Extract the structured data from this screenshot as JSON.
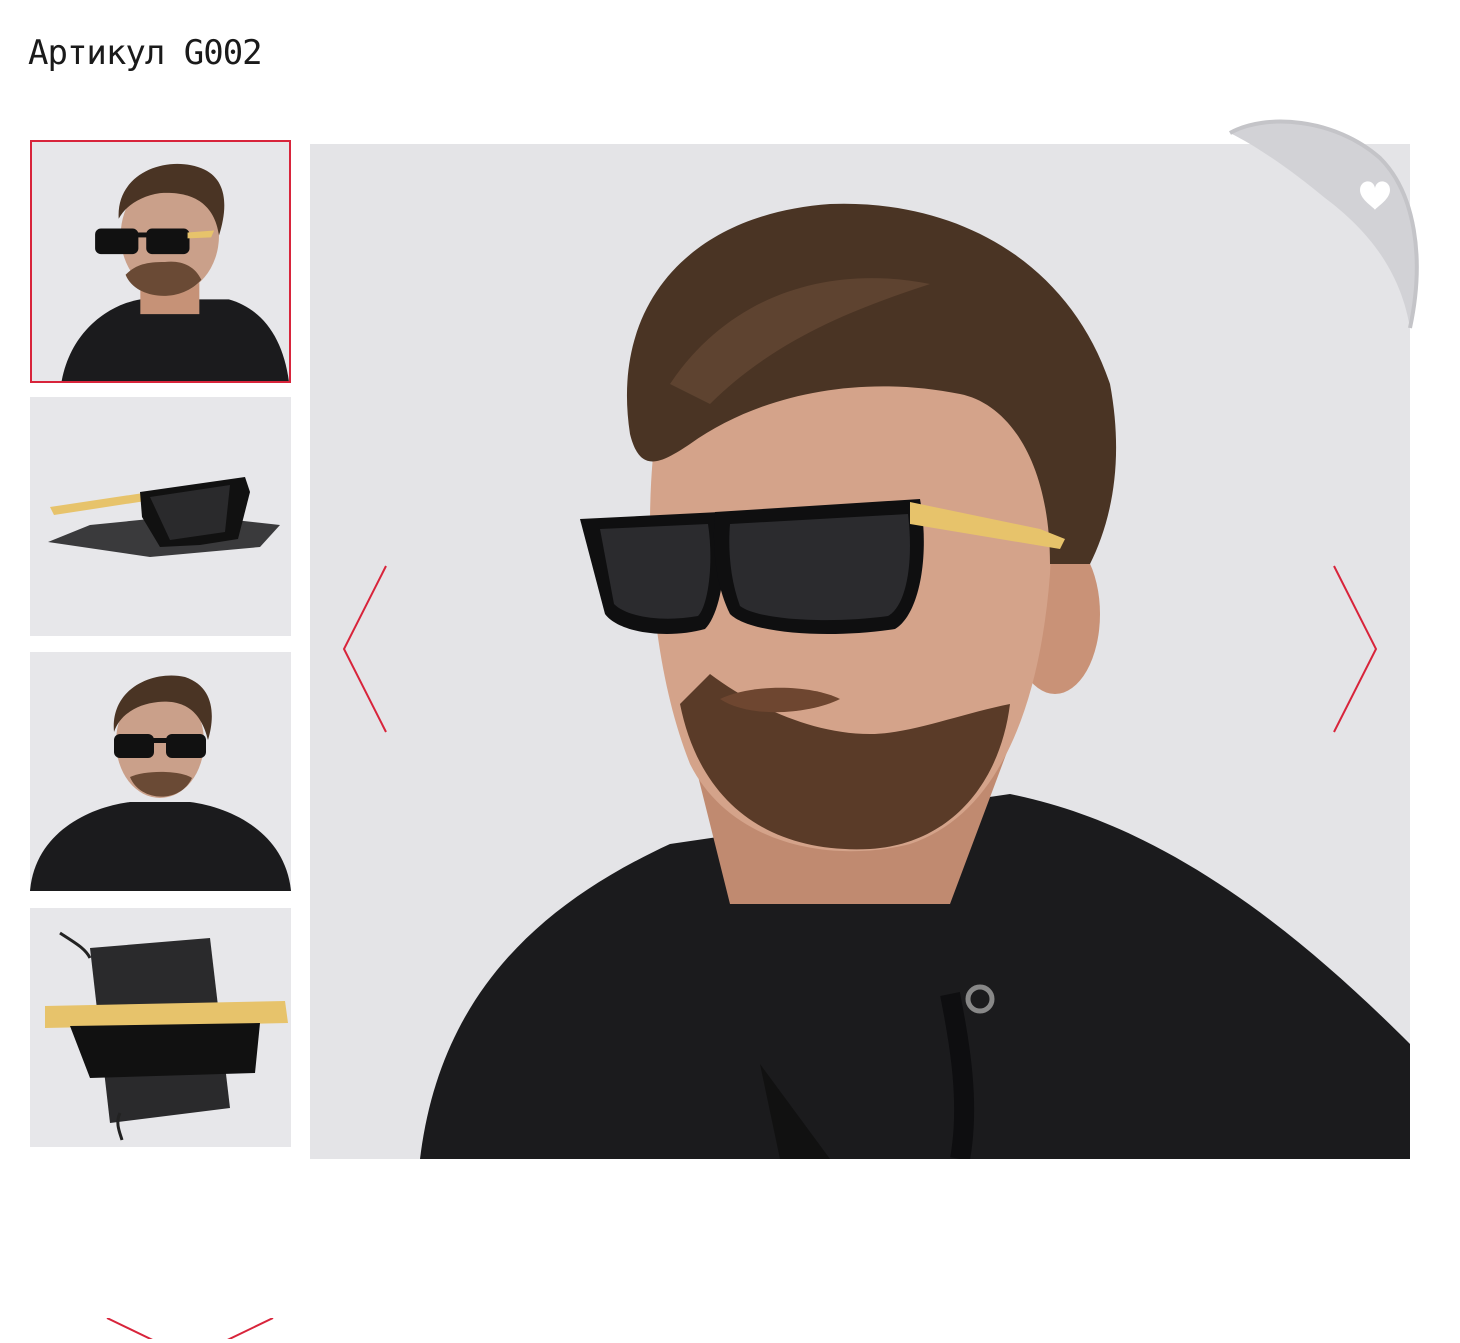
{
  "product": {
    "sku_label": "Артикул G002"
  },
  "gallery": {
    "thumbnails": [
      {
        "alt": "front-angled",
        "active": true
      },
      {
        "alt": "side-on-pouch",
        "active": false
      },
      {
        "alt": "front-straight",
        "active": false
      },
      {
        "alt": "folded-on-pouch",
        "active": false
      }
    ],
    "main_image": {
      "alt": "front-angled"
    },
    "prev_icon": "chevron-left-icon",
    "next_icon": "chevron-right-icon",
    "thumb_scroll_icon": "chevron-down-icon",
    "favorite_icon": "heart-icon"
  },
  "colors": {
    "accent": "#d8243b",
    "photo_bg": "#e4e4e7",
    "hoodie": "#1b1b1d",
    "hair": "#4a3424",
    "skin": "#c9957a",
    "temple": "#e7c36b"
  }
}
